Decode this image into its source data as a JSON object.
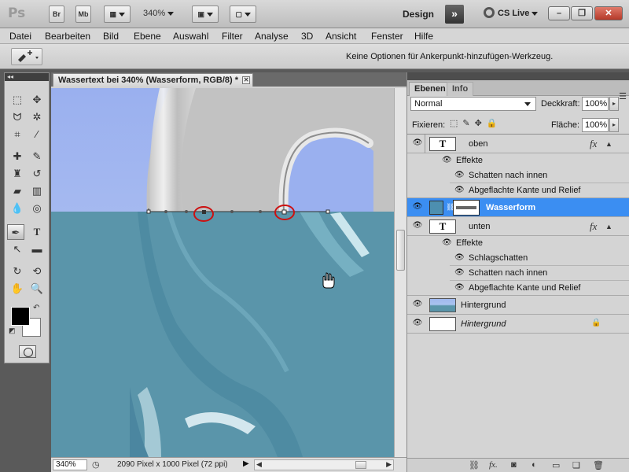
{
  "app": {
    "logo": "Ps",
    "bridge_label": "Br",
    "minibridge_label": "Mb",
    "zoom": "340%",
    "workspace": "Design",
    "cs_live": "CS Live",
    "minimize": "–",
    "restore": "❐",
    "close": "✕"
  },
  "menu": [
    "Datei",
    "Bearbeiten",
    "Bild",
    "Ebene",
    "Auswahl",
    "Filter",
    "Analyse",
    "3D",
    "Ansicht",
    "Fenster",
    "Hilfe"
  ],
  "options": {
    "message": "Keine Optionen für Ankerpunkt-hinzufügen-Werkzeug."
  },
  "document": {
    "tab_title": "Wassertext bei 340% (Wasserform, RGB/8) *",
    "zoom": "340%",
    "info": "2090 Pixel x 1000 Pixel (72 ppi)"
  },
  "layers_panel": {
    "tabs": [
      "Ebenen",
      "Info"
    ],
    "blend_mode": "Normal",
    "opacity_label": "Deckkraft:",
    "opacity": "100%",
    "lock_label": "Fixieren:",
    "fill_label": "Fläche:",
    "fill": "100%",
    "layers": [
      {
        "name": "oben",
        "thumb": "T",
        "fx": "fx"
      },
      {
        "name": "Effekte"
      },
      {
        "name": "Schatten nach innen"
      },
      {
        "name": "Abgeflachte Kante und Relief"
      },
      {
        "name": "Wasserform",
        "selected": true
      },
      {
        "name": "unten",
        "thumb": "T",
        "fx": "fx"
      },
      {
        "name": "Effekte"
      },
      {
        "name": "Schlagschatten"
      },
      {
        "name": "Schatten nach innen"
      },
      {
        "name": "Abgeflachte Kante und Relief"
      },
      {
        "name": "Hintergrund"
      },
      {
        "name": "Hintergrund",
        "locked": true
      }
    ]
  },
  "colors": {
    "accent": "#3b8ef2",
    "water": "#5a95aa",
    "sky": "#9db3f2",
    "anchor_highlight": "#cc1111"
  }
}
